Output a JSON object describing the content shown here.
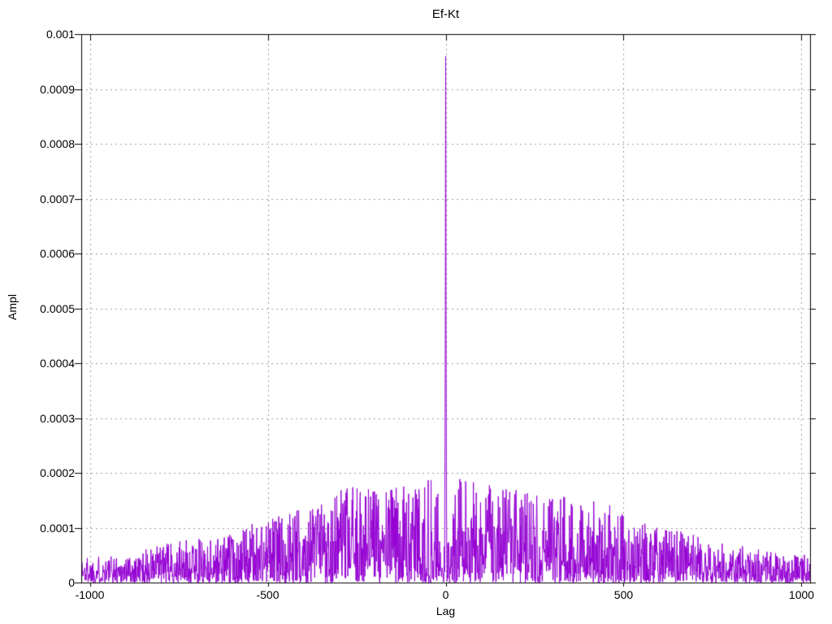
{
  "chart_data": {
    "type": "line",
    "title": "Ef-Kt",
    "xlabel": "Lag",
    "ylabel": "Ampl",
    "xlim": [
      -1024,
      1024
    ],
    "ylim": [
      0,
      0.001
    ],
    "grid": "dotted",
    "legend": "none",
    "background_color": "#ffffff",
    "border_color": "#000000",
    "grid_color": "#9a9a9a",
    "line_color": "#9400d3",
    "x_ticks": [
      {
        "value": -1000,
        "label": "-1000"
      },
      {
        "value": -500,
        "label": "-500"
      },
      {
        "value": 0,
        "label": "0"
      },
      {
        "value": 500,
        "label": "500"
      },
      {
        "value": 1000,
        "label": "1000"
      }
    ],
    "y_ticks": [
      {
        "value": 0.0,
        "label": "0"
      },
      {
        "value": 0.0001,
        "label": "0.0001"
      },
      {
        "value": 0.0002,
        "label": "0.0002"
      },
      {
        "value": 0.0003,
        "label": "0.0003"
      },
      {
        "value": 0.0004,
        "label": "0.0004"
      },
      {
        "value": 0.0005,
        "label": "0.0005"
      },
      {
        "value": 0.0006,
        "label": "0.0006"
      },
      {
        "value": 0.0007,
        "label": "0.0007"
      },
      {
        "value": 0.0008,
        "label": "0.0008"
      },
      {
        "value": 0.0009,
        "label": "0.0009"
      },
      {
        "value": 0.001,
        "label": "0.001"
      }
    ],
    "n_points": 2049,
    "peak_points": [
      {
        "lag": -2,
        "ampl": 0.00022
      },
      {
        "lag": -1,
        "ampl": 0.00045
      },
      {
        "lag": 0,
        "ampl": 0.00096
      },
      {
        "lag": 1,
        "ampl": 0.00049
      },
      {
        "lag": 2,
        "ampl": 0.0002
      }
    ],
    "center_dip": {
      "from_abs_lag": 3,
      "to_abs_lag": 20,
      "factor": 0.4
    },
    "noise_envelope": {
      "lags": [
        -1024,
        -900,
        -800,
        -700,
        -600,
        -500,
        -400,
        -300,
        -200,
        -100,
        -40,
        40,
        100,
        200,
        300,
        400,
        500,
        600,
        700,
        800,
        900,
        1024
      ],
      "max_ampl": [
        5e-05,
        5e-05,
        7e-05,
        8e-05,
        9e-05,
        0.00012,
        0.00014,
        0.00017,
        0.00018,
        0.00018,
        0.00019,
        0.00019,
        0.00018,
        0.00017,
        0.00016,
        0.00016,
        0.00013,
        0.0001,
        9e-05,
        7e-05,
        6e-05,
        5e-05
      ]
    }
  }
}
